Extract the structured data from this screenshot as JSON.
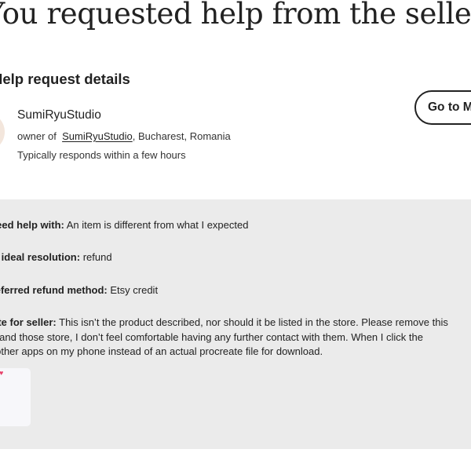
{
  "page": {
    "title": "You requested help from the seller"
  },
  "help_request": {
    "heading": "Help request details",
    "seller": {
      "name": "SumiRyuStudio",
      "owner_prefix": "owner of",
      "shop_link": "SumiRyuStudio",
      "location": ", Bucharest, Romania",
      "response_time": "Typically responds within a few hours"
    },
    "go_button_label": "Go to Messages",
    "details": {
      "help_label": "I need help with:",
      "help_value": "An item is different from what I expected",
      "resolution_label": "My ideal resolution:",
      "resolution_value": "refund",
      "method_label": "Preferred refund method:",
      "method_value": "Etsy credit",
      "note_label": "Note for seller:",
      "note_line1": "This isn’t the product described, nor should it be listed in the store. Please remove this",
      "note_line2": "or and those store, I don’t feel comfortable having any further contact with them. When I click the",
      "note_line3": "s other apps on my phone instead of an actual procreate file for download."
    },
    "attachment": {
      "icon": "heart-icon",
      "glyph": "♥"
    }
  }
}
